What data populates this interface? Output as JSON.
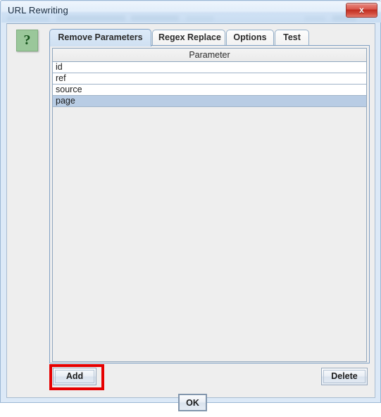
{
  "window": {
    "title": "URL Rewriting",
    "close_label": "x"
  },
  "help": {
    "label": "?"
  },
  "tabs": [
    {
      "label": "Remove Parameters",
      "selected": true
    },
    {
      "label": "Regex Replace",
      "selected": false
    },
    {
      "label": "Options",
      "selected": false
    },
    {
      "label": "Test",
      "selected": false
    }
  ],
  "table": {
    "column_header": "Parameter",
    "rows": [
      {
        "value": "id",
        "selected": false
      },
      {
        "value": "ref",
        "selected": false
      },
      {
        "value": "source",
        "selected": false
      },
      {
        "value": "page",
        "selected": true
      }
    ]
  },
  "buttons": {
    "add": "Add",
    "delete": "Delete",
    "ok": "OK"
  },
  "colors": {
    "selected_row": "#b8cce4",
    "annotation": "#e60000",
    "titlebar": "#ddeaf8",
    "close_button": "#c22e22",
    "help_button": "#9ac79a"
  }
}
